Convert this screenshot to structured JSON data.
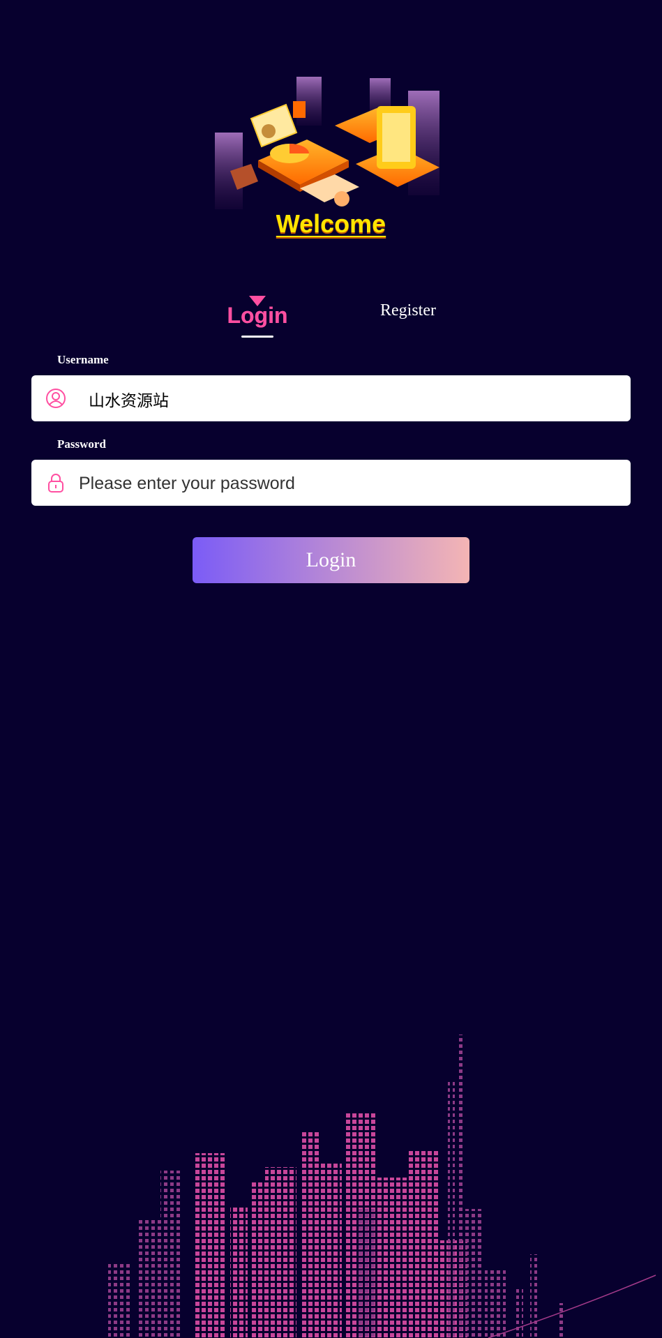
{
  "header": {
    "welcome": "Welcome"
  },
  "tabs": {
    "login_label": "Login",
    "register_label": "Register"
  },
  "form": {
    "username_label": "Username",
    "username_value": "山水资源站",
    "password_label": "Password",
    "password_placeholder": "Please enter your password",
    "login_button": "Login"
  },
  "colors": {
    "background": "#07002e",
    "accent_pink": "#ff4fa1",
    "welcome_yellow": "#ffe600",
    "button_gradient_start": "#7b5cf6",
    "button_gradient_end": "#f4b5b4"
  }
}
